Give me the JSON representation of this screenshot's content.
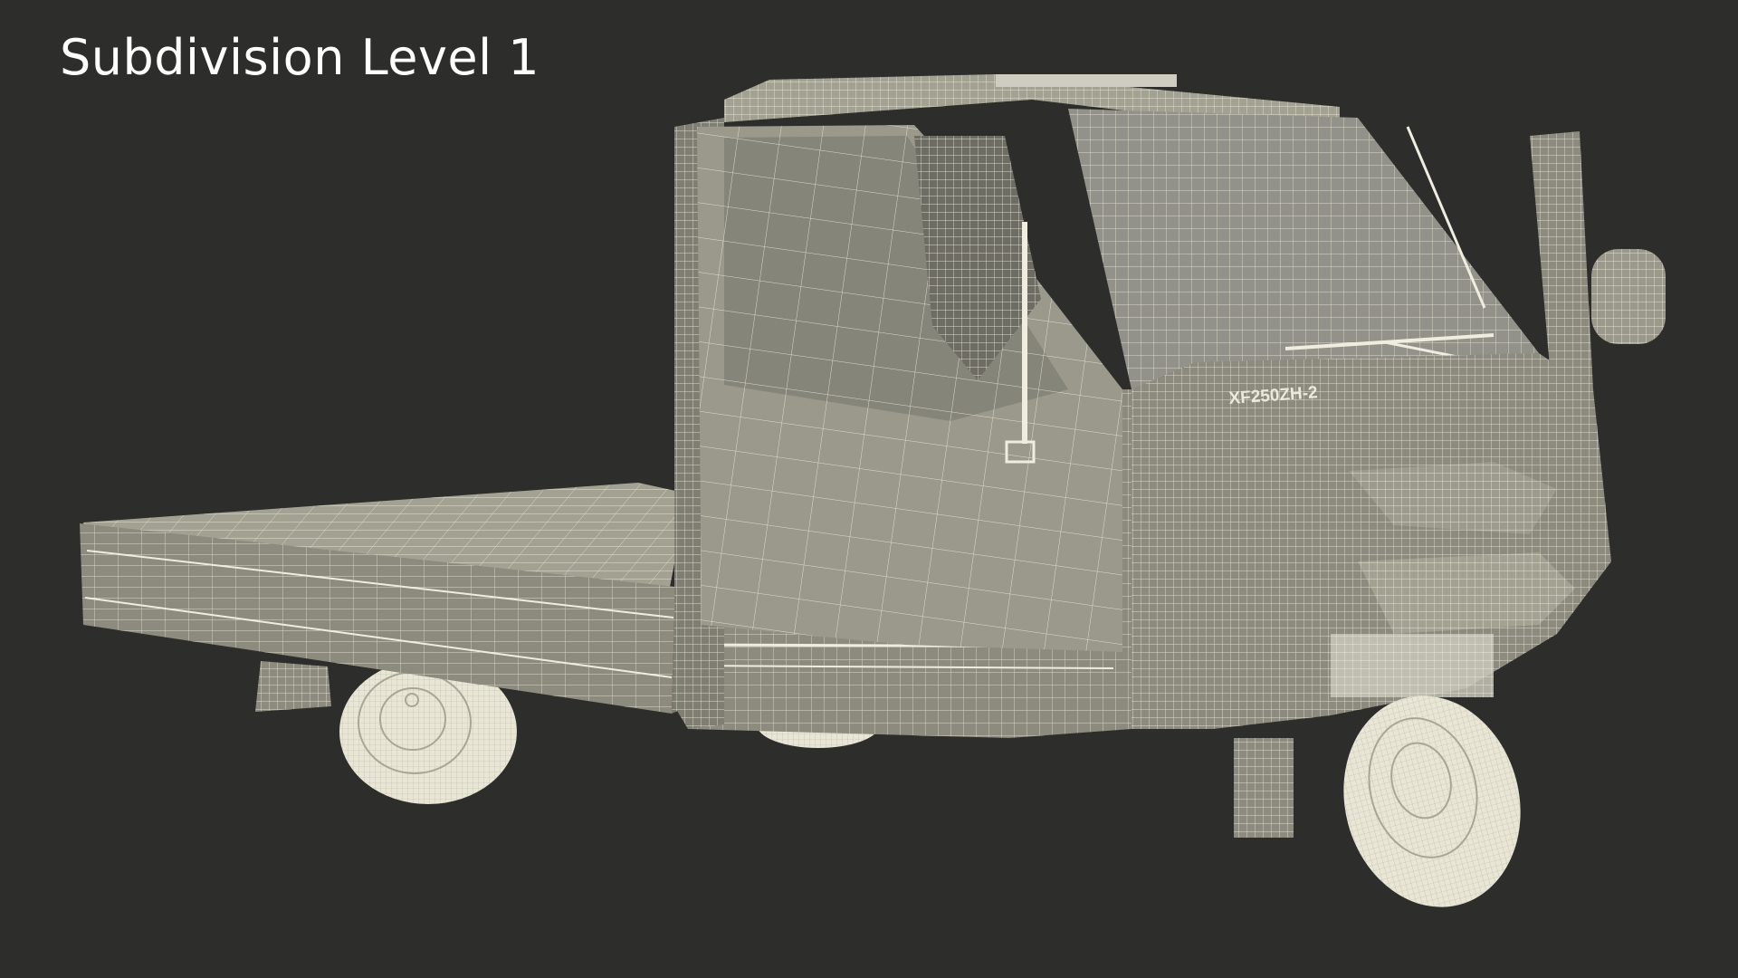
{
  "title": "Subdivision Level 1",
  "plate_text": "XF250ZH-2",
  "colors": {
    "background": "#2d2d2b",
    "title_text": "#ffffff",
    "body_fill": "#8c8b7e",
    "wire": "#efede0",
    "tire": "#e9e6d6"
  },
  "subject": "three-wheeled flatbed cargo vehicle wireframe render"
}
